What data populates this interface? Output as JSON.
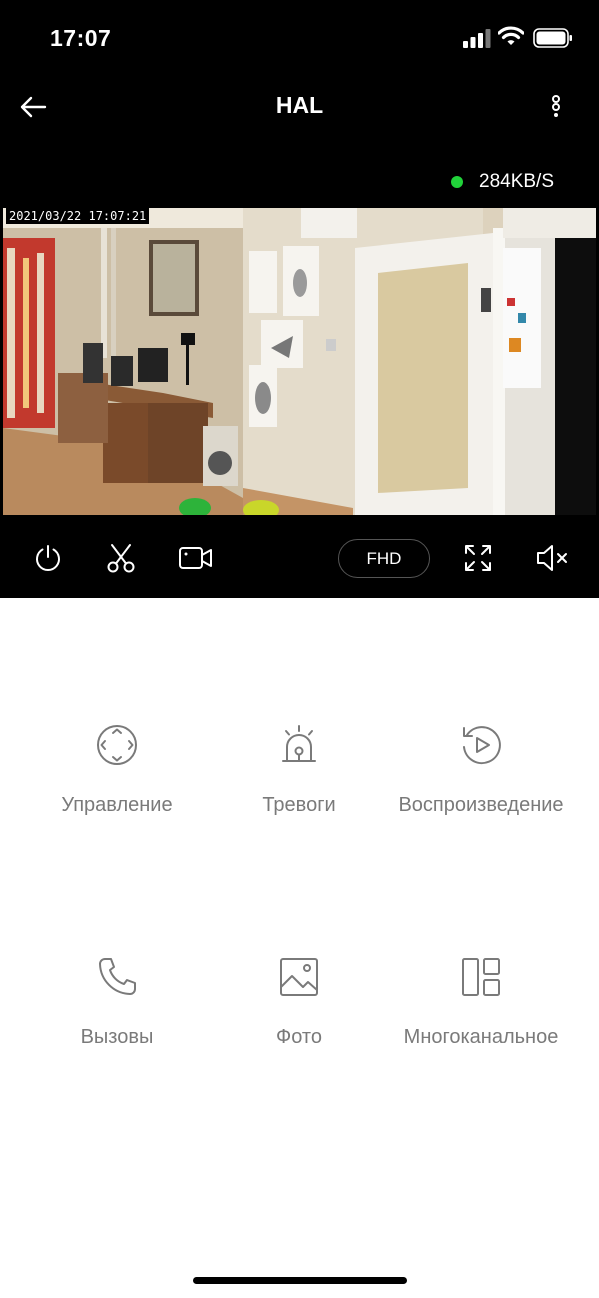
{
  "status_bar": {
    "time": "17:07"
  },
  "nav": {
    "title": "HAL"
  },
  "stream": {
    "speed": "284KB/S",
    "timestamp": "2021/03/22  17:07:21",
    "status_color": "#21d23a"
  },
  "controls": {
    "quality_label": "FHD"
  },
  "menu": [
    {
      "label": "Управление",
      "icon": "direction-pad-icon"
    },
    {
      "label": "Тревоги",
      "icon": "alarm-siren-icon"
    },
    {
      "label": "Воспроизведение",
      "icon": "playback-icon"
    },
    {
      "label": "Вызовы",
      "icon": "phone-icon"
    },
    {
      "label": "Фото",
      "icon": "photo-icon"
    },
    {
      "label": "Многоканальное",
      "icon": "multichannel-icon"
    }
  ]
}
